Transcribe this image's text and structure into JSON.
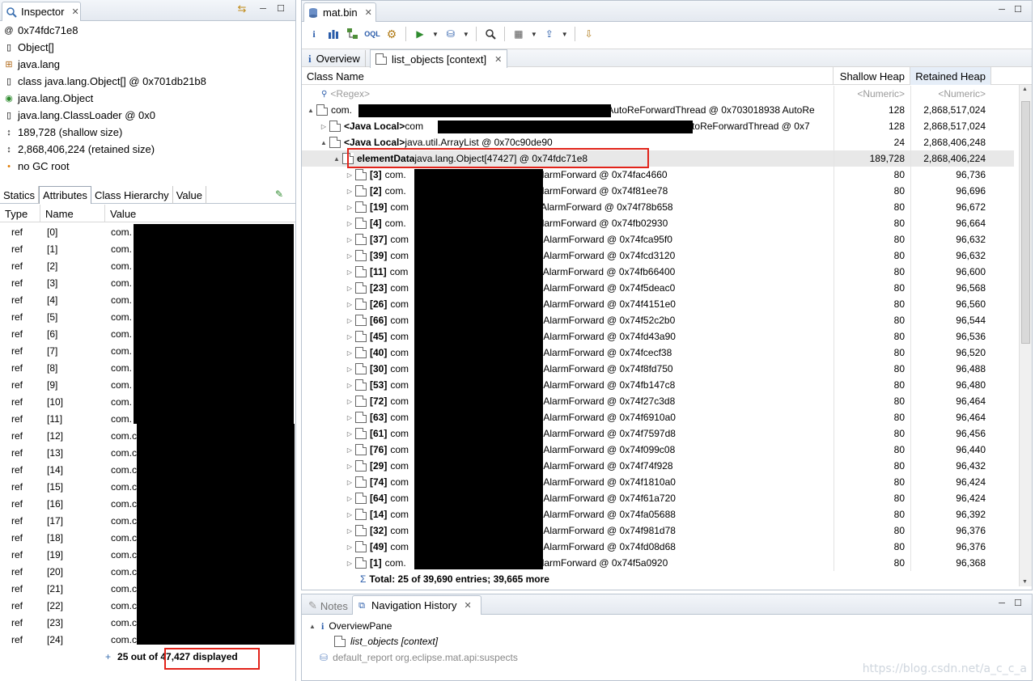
{
  "inspector": {
    "title": "Inspector",
    "rows": [
      {
        "icon": "at-icon",
        "text": "0x74fdc71e8"
      },
      {
        "icon": "class-icon",
        "text": "Object[]"
      },
      {
        "icon": "package-icon",
        "text": "java.lang"
      },
      {
        "icon": "class-icon",
        "text": "class java.lang.Object[] @ 0x701db21b8"
      },
      {
        "icon": "class-gc-icon",
        "text": "java.lang.Object"
      },
      {
        "icon": "classloader-icon",
        "text": "java.lang.ClassLoader @ 0x0"
      },
      {
        "icon": "shallow-size-icon",
        "text": "189,728 (shallow size)"
      },
      {
        "icon": "retained-size-icon",
        "text": "2,868,406,224 (retained size)"
      },
      {
        "icon": "gc-root-dot-icon",
        "text": "no GC root"
      }
    ],
    "subtabs": [
      "Statics",
      "Attributes",
      "Class Hierarchy",
      "Value"
    ],
    "columns": [
      "Type",
      "Name",
      "Value"
    ],
    "attr_rows": [
      {
        "type": "ref",
        "name": "[0]",
        "value": "com."
      },
      {
        "type": "ref",
        "name": "[1]",
        "value": "com."
      },
      {
        "type": "ref",
        "name": "[2]",
        "value": "com."
      },
      {
        "type": "ref",
        "name": "[3]",
        "value": "com."
      },
      {
        "type": "ref",
        "name": "[4]",
        "value": "com."
      },
      {
        "type": "ref",
        "name": "[5]",
        "value": "com."
      },
      {
        "type": "ref",
        "name": "[6]",
        "value": "com."
      },
      {
        "type": "ref",
        "name": "[7]",
        "value": "com."
      },
      {
        "type": "ref",
        "name": "[8]",
        "value": "com."
      },
      {
        "type": "ref",
        "name": "[9]",
        "value": "com."
      },
      {
        "type": "ref",
        "name": "[10]",
        "value": "com."
      },
      {
        "type": "ref",
        "name": "[11]",
        "value": "com."
      },
      {
        "type": "ref",
        "name": "[12]",
        "value": "com.c"
      },
      {
        "type": "ref",
        "name": "[13]",
        "value": "com.c"
      },
      {
        "type": "ref",
        "name": "[14]",
        "value": "com.c"
      },
      {
        "type": "ref",
        "name": "[15]",
        "value": "com.c"
      },
      {
        "type": "ref",
        "name": "[16]",
        "value": "com.c"
      },
      {
        "type": "ref",
        "name": "[17]",
        "value": "com.c"
      },
      {
        "type": "ref",
        "name": "[18]",
        "value": "com.c"
      },
      {
        "type": "ref",
        "name": "[19]",
        "value": "com.c"
      },
      {
        "type": "ref",
        "name": "[20]",
        "value": "com.c"
      },
      {
        "type": "ref",
        "name": "[21]",
        "value": "com.c"
      },
      {
        "type": "ref",
        "name": "[22]",
        "value": "com.c"
      },
      {
        "type": "ref",
        "name": "[23]",
        "value": "com.c"
      },
      {
        "type": "ref",
        "name": "[24]",
        "value": "com.c"
      }
    ],
    "footer": "25 out of 47,427 displayed"
  },
  "editor": {
    "title": "mat.bin",
    "tabs": [
      "Overview",
      "list_objects [context]"
    ],
    "columns": [
      "Class Name",
      "Shallow Heap",
      "Retained Heap"
    ],
    "filter": {
      "name": "<Regex>",
      "shallow": "<Numeric>",
      "retained": "<Numeric>"
    },
    "rows": [
      {
        "indent": 0,
        "twisty": "▲",
        "bold": "",
        "text": "com.",
        "suffix": ".AutoReForwardThread @ 0x703018938  AutoRe",
        "shallow": "128",
        "retained": "2,868,517,024"
      },
      {
        "indent": 1,
        "twisty": "▷",
        "bold": "<Java Local>",
        "text": " com",
        "suffix": ".AutoReForwardThread @ 0x7",
        "shallow": "128",
        "retained": "2,868,517,024"
      },
      {
        "indent": 1,
        "twisty": "▲",
        "bold": "<Java Local>",
        "text": " java.util.ArrayList @ 0x70c90de90",
        "suffix": "",
        "shallow": "24",
        "retained": "2,868,406,248"
      },
      {
        "indent": 2,
        "twisty": "▲",
        "bold": "elementData",
        "text": " java.lang.Object[47427] @ 0x74fdc71e8",
        "suffix": "",
        "shallow": "189,728",
        "retained": "2,868,406,224"
      }
    ],
    "children": [
      {
        "idx": "[3]",
        "pre": "com.",
        "suffix": "AlarmForward @ 0x74fac4660",
        "shallow": "80",
        "retained": "96,736"
      },
      {
        "idx": "[2]",
        "pre": "com.",
        "suffix": "AlarmForward @ 0x74f81ee78",
        "shallow": "80",
        "retained": "96,696"
      },
      {
        "idx": "[19]",
        "pre": "com",
        "suffix": "AlarmForward @ 0x74f78b658",
        "shallow": "80",
        "retained": "96,672"
      },
      {
        "idx": "[4]",
        "pre": "com.",
        "suffix": "AlarmForward @ 0x74fb02930",
        "shallow": "80",
        "retained": "96,664"
      },
      {
        "idx": "[37]",
        "pre": "com",
        "suffix": ".AlarmForward @ 0x74fca95f0",
        "shallow": "80",
        "retained": "96,632"
      },
      {
        "idx": "[39]",
        "pre": "com",
        "suffix": ".AlarmForward @ 0x74fcd3120",
        "shallow": "80",
        "retained": "96,632"
      },
      {
        "idx": "[11]",
        "pre": "com",
        "suffix": ".AlarmForward @ 0x74fb66400",
        "shallow": "80",
        "retained": "96,600"
      },
      {
        "idx": "[23]",
        "pre": "com",
        "suffix": ".AlarmForward @ 0x74f5deac0",
        "shallow": "80",
        "retained": "96,568"
      },
      {
        "idx": "[26]",
        "pre": "com",
        "suffix": ".AlarmForward @ 0x74f4151e0",
        "shallow": "80",
        "retained": "96,560"
      },
      {
        "idx": "[66]",
        "pre": "com",
        "suffix": ".AlarmForward @ 0x74f52c2b0",
        "shallow": "80",
        "retained": "96,544"
      },
      {
        "idx": "[45]",
        "pre": "com",
        "suffix": ".AlarmForward @ 0x74fd43a90",
        "shallow": "80",
        "retained": "96,536"
      },
      {
        "idx": "[40]",
        "pre": "com",
        "suffix": ".AlarmForward @ 0x74fcecf38",
        "shallow": "80",
        "retained": "96,520"
      },
      {
        "idx": "[30]",
        "pre": "com",
        "suffix": ".AlarmForward @ 0x74f8fd750",
        "shallow": "80",
        "retained": "96,488"
      },
      {
        "idx": "[53]",
        "pre": "com",
        "suffix": ".AlarmForward @ 0x74fb147c8",
        "shallow": "80",
        "retained": "96,480"
      },
      {
        "idx": "[72]",
        "pre": "com",
        "suffix": ".AlarmForward @ 0x74f27c3d8",
        "shallow": "80",
        "retained": "96,464"
      },
      {
        "idx": "[63]",
        "pre": "com",
        "suffix": ".AlarmForward @ 0x74f6910a0",
        "shallow": "80",
        "retained": "96,464"
      },
      {
        "idx": "[61]",
        "pre": "com",
        "suffix": ".AlarmForward @ 0x74f7597d8",
        "shallow": "80",
        "retained": "96,456"
      },
      {
        "idx": "[76]",
        "pre": "com",
        "suffix": ".AlarmForward @ 0x74f099c08",
        "shallow": "80",
        "retained": "96,440"
      },
      {
        "idx": "[29]",
        "pre": "com",
        "suffix": ".AlarmForward @ 0x74f74f928",
        "shallow": "80",
        "retained": "96,432"
      },
      {
        "idx": "[74]",
        "pre": "com",
        "suffix": ".AlarmForward @ 0x74f1810a0",
        "shallow": "80",
        "retained": "96,424"
      },
      {
        "idx": "[64]",
        "pre": "com",
        "suffix": ".AlarmForward @ 0x74f61a720",
        "shallow": "80",
        "retained": "96,424"
      },
      {
        "idx": "[14]",
        "pre": "com",
        "suffix": ".AlarmForward @ 0x74fa05688",
        "shallow": "80",
        "retained": "96,392"
      },
      {
        "idx": "[32]",
        "pre": "com",
        "suffix": ".AlarmForward @ 0x74f981d78",
        "shallow": "80",
        "retained": "96,376"
      },
      {
        "idx": "[49]",
        "pre": "com",
        "suffix": ".AlarmForward @ 0x74fd08d68",
        "shallow": "80",
        "retained": "96,376"
      },
      {
        "idx": "[1]",
        "pre": "com.",
        "suffix": "AlarmForward @ 0x74f5a0920",
        "shallow": "80",
        "retained": "96,368"
      }
    ],
    "total": "Total: 25 of 39,690 entries; 39,665 more"
  },
  "bottom": {
    "tabs": [
      "Notes",
      "Navigation History"
    ],
    "items": [
      {
        "indent": 0,
        "text": "OverviewPane",
        "italic": false,
        "grey": false
      },
      {
        "indent": 1,
        "text": "list_objects [context]",
        "italic": true,
        "grey": false
      },
      {
        "indent": 0,
        "text": "default_report  org.eclipse.mat.api:suspects",
        "italic": false,
        "grey": true
      }
    ]
  },
  "watermark": "https://blog.csdn.net/a_c_c_a",
  "colors": {
    "highlight": "#e2231a",
    "selected_row": "#e8e8e8",
    "tab_border": "#b9c3cf"
  }
}
